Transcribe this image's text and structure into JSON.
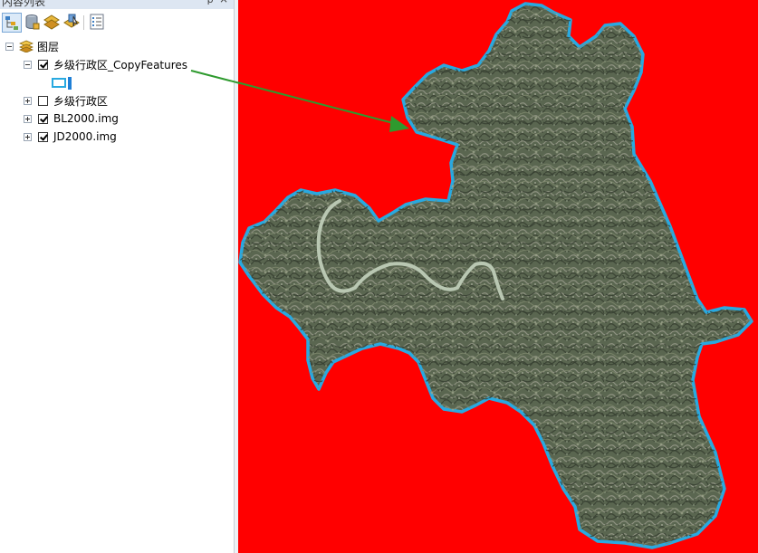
{
  "panel": {
    "title": "内容列表",
    "pin_glyph": "ᵽ",
    "close_glyph": "×",
    "toolbar_icons": [
      "list-by-drawing-order-icon",
      "list-by-source-icon",
      "list-by-visibility-icon",
      "list-by-selection-icon",
      "options-icon"
    ]
  },
  "tree": {
    "root_label": "图层",
    "layers": [
      {
        "label": "乡级行政区_CopyFeatures",
        "checked": true,
        "expanded": true
      },
      {
        "label": "乡级行政区",
        "checked": false,
        "expanded": false
      },
      {
        "label": "BL2000.img",
        "checked": true,
        "expanded": false
      },
      {
        "label": "JD2000.img",
        "checked": true,
        "expanded": false
      }
    ]
  },
  "colors": {
    "map_background": "#ff0000",
    "boundary": "#29a9e0",
    "arrow": "#2e9a2e",
    "terrain": "#5d6a4e",
    "river": "#b9c7b2"
  }
}
